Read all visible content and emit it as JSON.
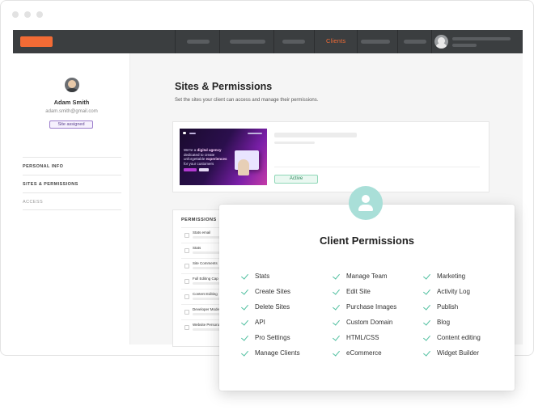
{
  "topbar": {
    "active_nav": "Clients",
    "accent_color": "#f26b35",
    "logo": "orange-logo-placeholder",
    "avatar": "user-avatar-icon"
  },
  "sidebar": {
    "name": "Adam Smith",
    "email": "adam.smith@gmail.com",
    "badge": "Site assigned",
    "menu": [
      {
        "label": "PERSONAL INFO"
      },
      {
        "label": "SITES & PERMISSIONS"
      },
      {
        "label": "ACCESS"
      }
    ]
  },
  "main": {
    "title": "Sites & Permissions",
    "subtitle": "Set the sites your client can access and manage their permissions.",
    "site_card": {
      "status": "Active",
      "thumbnail": {
        "headline_pre": "We're a ",
        "headline_hl1": "digital agency",
        "headline_mid": " dedicated to create unforgettable ",
        "headline_hl2": "experiences",
        "headline_post": " for your customers"
      }
    },
    "permissions_panel": {
      "header": "PERMISSIONS",
      "rows": [
        {
          "label": "Stats email"
        },
        {
          "label": "Stats"
        },
        {
          "label": "Site Comments"
        },
        {
          "label": "Full Editing Cap"
        },
        {
          "label": "Content Editing"
        },
        {
          "label": "Developer Mode"
        },
        {
          "label": "Website Personal"
        }
      ]
    }
  },
  "popup": {
    "title": "Client Permissions",
    "icon": "user-icon",
    "check_color": "#4fbf9f",
    "columns": [
      [
        "Stats",
        "Create Sites",
        "Delete Sites",
        "API",
        "Pro Settings",
        "Manage Clients"
      ],
      [
        "Manage Team",
        "Edit Site",
        "Purchase Images",
        "Custom Domain",
        "HTML/CSS",
        "eCommerce"
      ],
      [
        "Marketing",
        "Activity Log",
        "Publish",
        "Blog",
        "Content editing",
        "Widget Builder"
      ]
    ]
  }
}
